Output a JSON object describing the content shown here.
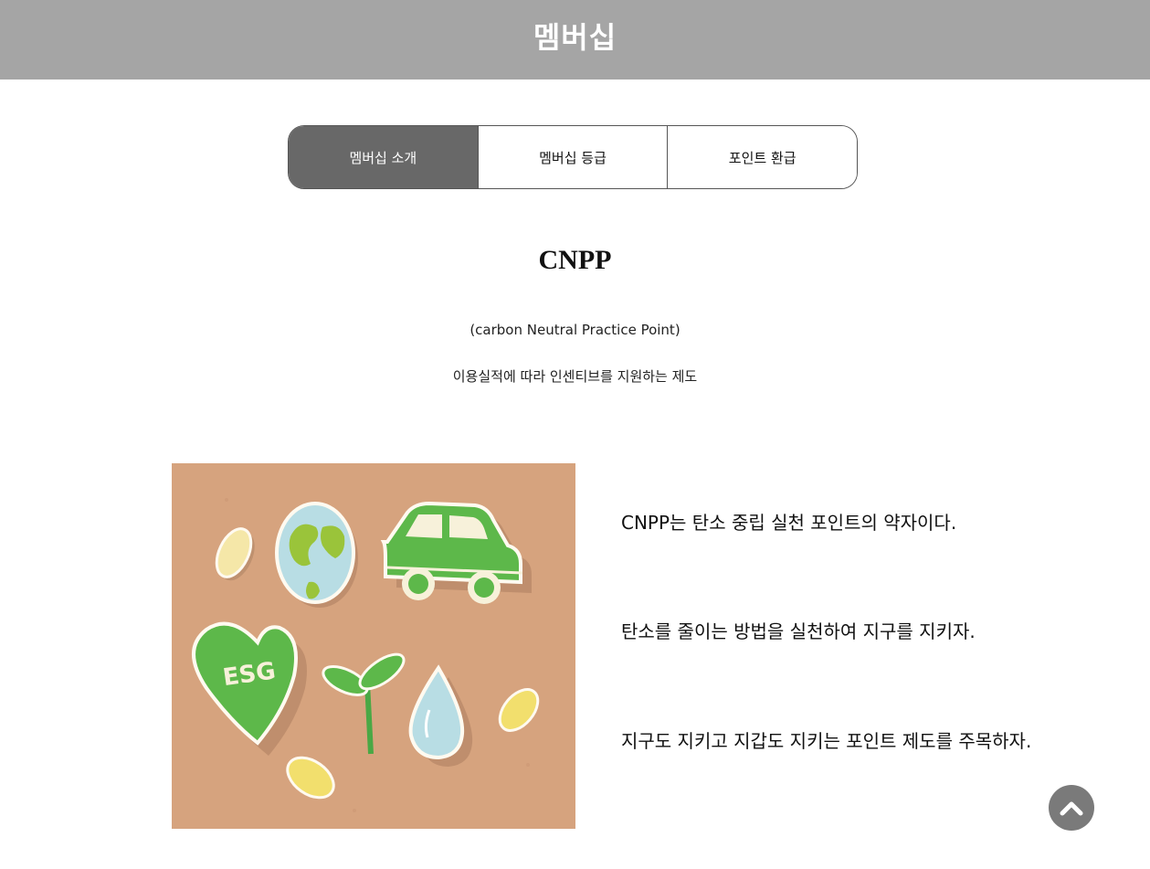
{
  "header": {
    "title": "멤버십"
  },
  "tabs": [
    {
      "label": "멤버십 소개",
      "active": true
    },
    {
      "label": "멤버십 등급",
      "active": false
    },
    {
      "label": "포인트 환급",
      "active": false
    }
  ],
  "intro": {
    "title": "CNPP",
    "subtitle": "(carbon Neutral Practice Point)",
    "description": "이용실적에 따라 인센티브를 지원하는 제도"
  },
  "image": {
    "esg_text": "ESG"
  },
  "content": {
    "lines": [
      "CNPP는 탄소 중립 실천 포인트의 약자이다.",
      "탄소를 줄이는 방법을 실천하여 지구를 지키자.",
      "지구도 지키고 지갑도 지키는 포인트 제도를 주목하자."
    ]
  },
  "scroll_top": {
    "icon": "chevron-up-icon"
  },
  "colors": {
    "header_bg": "#a5a5a5",
    "active_tab_bg": "#686868",
    "scroll_button_bg": "#7a7a7a",
    "image_bg": "#d4a27c"
  }
}
